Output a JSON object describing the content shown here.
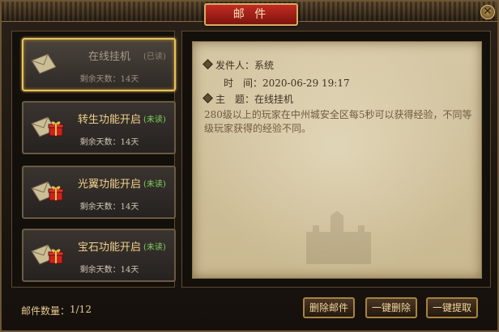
{
  "window": {
    "title": "邮 件",
    "close_symbol": "✕"
  },
  "mail_list": [
    {
      "title": "在线挂机",
      "status": "(已读)",
      "days": "剩余天数：14天",
      "read": true,
      "selected": true,
      "has_gift": false
    },
    {
      "title": "转生功能开启",
      "status": "(未读)",
      "days": "剩余天数：14天",
      "read": false,
      "selected": false,
      "has_gift": true
    },
    {
      "title": "光翼功能开启",
      "status": "(未读)",
      "days": "剩余天数：14天",
      "read": false,
      "selected": false,
      "has_gift": true
    },
    {
      "title": "宝石功能开启",
      "status": "(未读)",
      "days": "剩余天数：14天",
      "read": false,
      "selected": false,
      "has_gift": true
    }
  ],
  "detail": {
    "sender_label": "发件人：",
    "sender": "系统",
    "time_label": "时　间：",
    "time": "2020-06-29 19:17",
    "subject_label": "主　题：",
    "subject": "在线挂机",
    "body": "280级以上的玩家在中州城安全区每5秒可以获得经验，不同等级玩家获得的经验不同。"
  },
  "footer": {
    "count_label": "邮件数量：",
    "count_value": "1/12",
    "delete_button": "删除邮件",
    "delete_all_button": "一键删除",
    "collect_all_button": "一键提取"
  },
  "colors": {
    "unread_status": "#7fd15e",
    "title_plate": "#c32b22",
    "gold_border": "#e8c25b"
  }
}
